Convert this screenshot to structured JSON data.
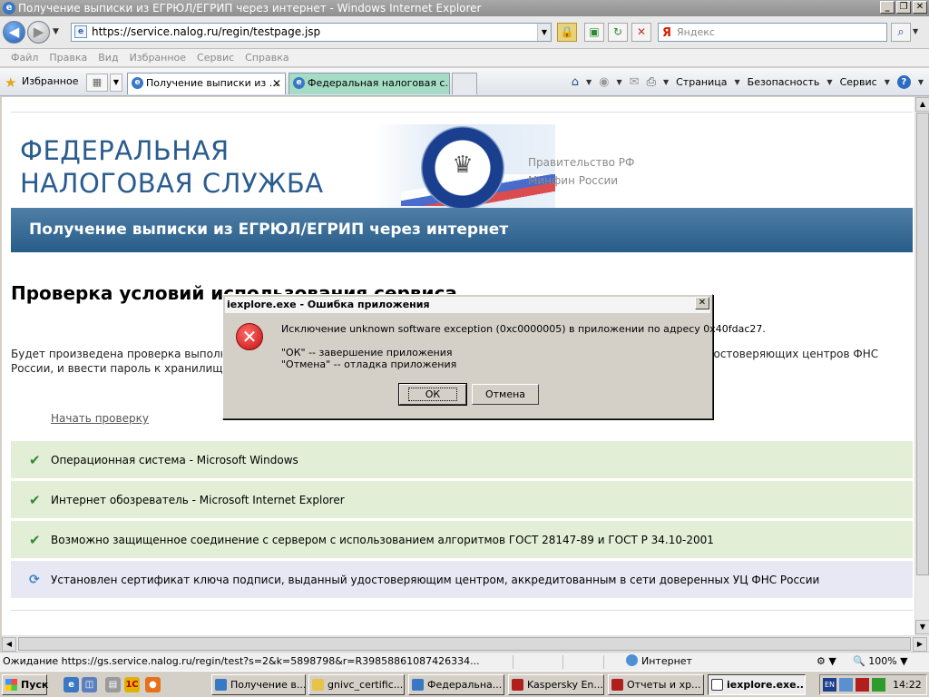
{
  "window": {
    "title": "Получение выписки из ЕГРЮЛ/ЕГРИП через интернет - Windows Internet Explorer",
    "minimize_label": "_",
    "maximize_label": "❐",
    "close_label": "✕"
  },
  "address_bar": {
    "url": "https://service.nalog.ru/regin/testpage.jsp",
    "search_placeholder": "Яндекс"
  },
  "menu": [
    "Файл",
    "Правка",
    "Вид",
    "Избранное",
    "Сервис",
    "Справка"
  ],
  "favorites": {
    "label": "Избранное"
  },
  "tabs": [
    {
      "label": "Получение выписки из ...",
      "active": true
    },
    {
      "label": "Федеральная налоговая с...",
      "active": false
    }
  ],
  "command_bar": {
    "page": "Страница",
    "safety": "Безопасность",
    "tools": "Сервис"
  },
  "page": {
    "logo_line1": "ФЕДЕРАЛЬНАЯ",
    "logo_line2": "НАЛОГОВАЯ СЛУЖБА",
    "emblem_text": "ФЕДЕРАЛЬНАЯ НАЛОГОВАЯ СЛУЖБА",
    "gov_link1": "Правительство РФ",
    "gov_link2": "Минфин России",
    "banner": "Получение выписки из ЕГРЮЛ/ЕГРИП через интернет",
    "heading": "Проверка условий использования сервиса",
    "description": "Будет произведена проверка выполнени                                                                                                                      дет предложено указать (выбрать) сертификат ключа подписи (СКП) (серти                                                                                                                     удостоверяющих центров ФНС России, и ввести пароль к хранилищу кл",
    "start_link": "Начать проверку",
    "checks": [
      {
        "text": "Операционная система - Microsoft Windows",
        "status": "ok"
      },
      {
        "text": "Интернет обозреватель - Microsoft Internet Explorer",
        "status": "ok"
      },
      {
        "text": "Возможно защищенное соединение с сервером с использованием алгоритмов ГОСТ 28147-89 и ГОСТ Р 34.10-2001",
        "status": "ok"
      },
      {
        "text": "Установлен сертификат ключа подписи, выданный удостоверяющим центром, аккредитованным в сети доверенных УЦ ФНС России",
        "status": "pending"
      }
    ]
  },
  "dialog": {
    "title": "iexplore.exe - Ошибка приложения",
    "message": "Исключение unknown software exception (0xc0000005) в приложении по адресу 0x40fdac27.",
    "line_ok": "\"ОК\" -- завершение приложения",
    "line_cancel": "\"Отмена\" -- отладка приложения",
    "ok_label": "ОК",
    "cancel_label": "Отмена"
  },
  "status_bar": {
    "text": "Ожидание https://gs.service.nalog.ru/regin/test?s=2&k=5898798&r=R39858861087426334...",
    "zone": "Интернет",
    "zoom": "100%"
  },
  "taskbar": {
    "start_label": "Пуск",
    "tasks": [
      {
        "label": "Получение в...",
        "active": false
      },
      {
        "label": "gnivc_certific...",
        "active": false
      },
      {
        "label": "Федеральна...",
        "active": false
      },
      {
        "label": "Kaspersky En...",
        "active": false
      },
      {
        "label": "Отчеты и хр...",
        "active": false
      },
      {
        "label": "iexplore.exe...",
        "active": true
      }
    ],
    "lang": "EN",
    "clock": "14:22"
  }
}
